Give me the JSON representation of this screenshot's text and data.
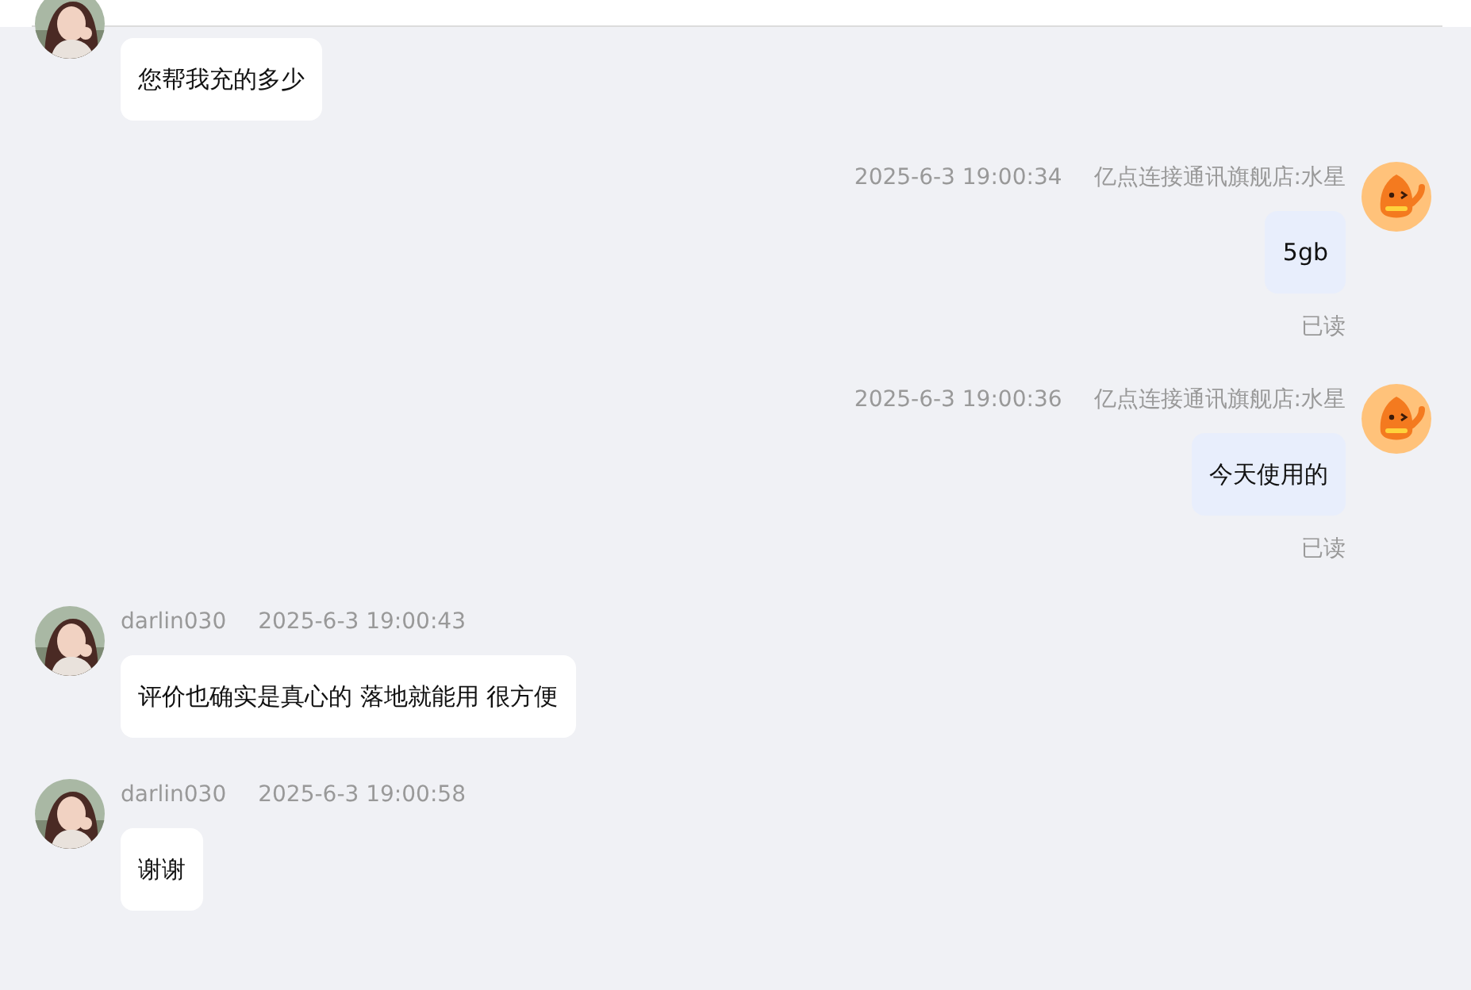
{
  "messages": [
    {
      "kind": "incoming",
      "clipped": true,
      "text": "您帮我充的多少"
    },
    {
      "kind": "outgoing",
      "time": "2025-6-3 19:00:34",
      "sender": "亿点连接通讯旗舰店:水星",
      "text": "5gb",
      "status": "已读"
    },
    {
      "kind": "outgoing",
      "time": "2025-6-3 19:00:36",
      "sender": "亿点连接通讯旗舰店:水星",
      "text": "今天使用的",
      "status": "已读"
    },
    {
      "kind": "incoming",
      "sender": "darlin030",
      "time": "2025-6-3 19:00:43",
      "text": "评价也确实是真心的 落地就能用 很方便"
    },
    {
      "kind": "incoming",
      "sender": "darlin030",
      "time": "2025-6-3 19:00:58",
      "text": "谢谢"
    }
  ]
}
